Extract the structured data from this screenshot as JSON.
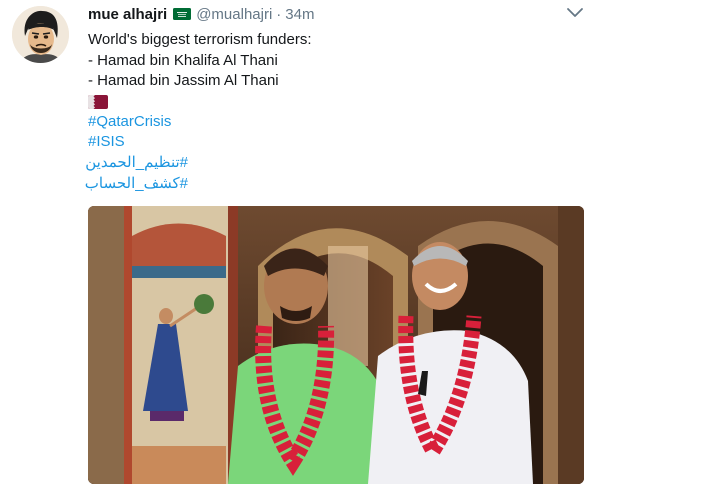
{
  "tweet": {
    "display_name": "mue alhajri",
    "handle": "@mualhajri",
    "separator": "·",
    "time": "34m",
    "lines": [
      "World's biggest terrorism funders:",
      "- Hamad bin Khalifa Al Thani",
      "- Hamad bin Jassim Al Thani"
    ],
    "hashtags": [
      "#QatarCrisis",
      "#ISIS",
      "#تنظيم_الحمدين",
      "#كشف_الحساب"
    ]
  },
  "icons": {
    "badge": "saudi-flag-icon",
    "flag": "qatar-flag-icon",
    "menu": "chevron-down-icon"
  },
  "colors": {
    "link": "#1b95e0",
    "muted": "#657786",
    "text": "#14171a",
    "saudi_green": "#006c35",
    "qatar_maroon": "#8a1538"
  }
}
